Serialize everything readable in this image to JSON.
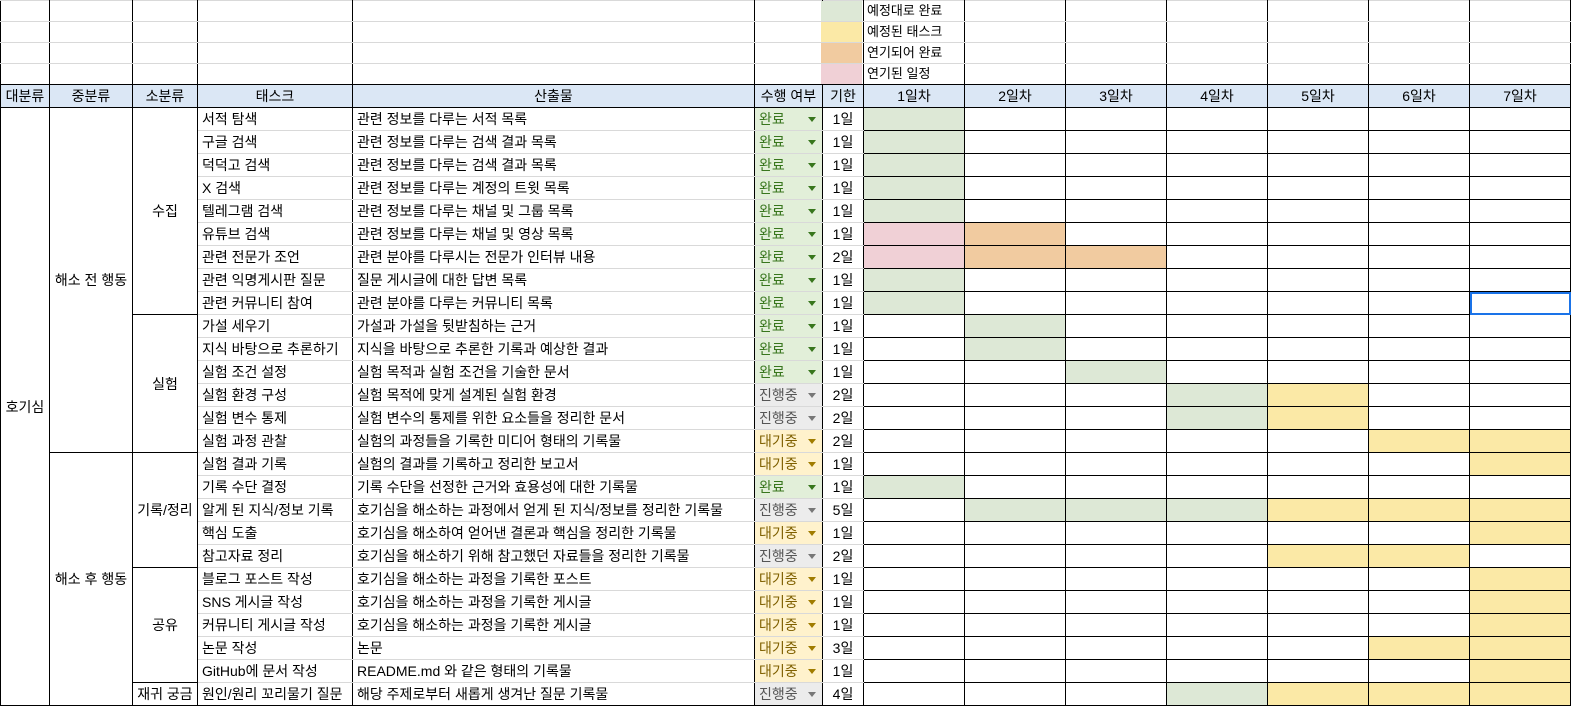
{
  "colors": {
    "header_bg": "#dbe7f5",
    "on_schedule_done": "#dde8d6",
    "scheduled_task": "#fbe9a6",
    "delayed_done": "#f1cba0",
    "delayed_schedule": "#f0d0d6",
    "status_done_bg": "#e2efd9",
    "status_done_text": "#38761d",
    "status_progress_bg": "#ececec",
    "status_progress_text": "#555555",
    "status_waiting_bg": "#fff2cc",
    "status_waiting_text": "#7f6000"
  },
  "legend": [
    {
      "label": "예정대로 완료",
      "color": "#dde8d6"
    },
    {
      "label": "예정된 태스크",
      "color": "#fbe9a6"
    },
    {
      "label": "연기되어 완료",
      "color": "#f1cba0"
    },
    {
      "label": "연기된 일정",
      "color": "#f0d0d6"
    }
  ],
  "headers": [
    "대분류",
    "중분류",
    "소분류",
    "태스크",
    "산출물",
    "수행 여부",
    "기한",
    "1일차",
    "2일차",
    "3일차",
    "4일차",
    "5일차",
    "6일차",
    "7일차"
  ],
  "major": "호기심",
  "mid_groups": [
    "해소 전 행동",
    "해소 후 행동"
  ],
  "sub_groups": [
    "수집",
    "실험",
    "기록/정리",
    "공유",
    "재귀 궁금"
  ],
  "rows": [
    {
      "task": "서적 탐색",
      "output": "관련 정보를 다루는 서적 목록",
      "status": "완료",
      "deadline": "1일",
      "days": [
        "G",
        "",
        "",
        "",
        "",
        "",
        ""
      ]
    },
    {
      "task": "구글 검색",
      "output": "관련 정보를 다루는 검색 결과 목록",
      "status": "완료",
      "deadline": "1일",
      "days": [
        "G",
        "",
        "",
        "",
        "",
        "",
        ""
      ]
    },
    {
      "task": "덕덕고 검색",
      "output": "관련 정보를 다루는 검색 결과 목록",
      "status": "완료",
      "deadline": "1일",
      "days": [
        "G",
        "",
        "",
        "",
        "",
        "",
        ""
      ]
    },
    {
      "task": "X 검색",
      "output": "관련 정보를 다루는 계정의 트윗 목록",
      "status": "완료",
      "deadline": "1일",
      "days": [
        "G",
        "",
        "",
        "",
        "",
        "",
        ""
      ]
    },
    {
      "task": "텔레그램 검색",
      "output": "관련 정보를 다루는 채널 및 그룹 목록",
      "status": "완료",
      "deadline": "1일",
      "days": [
        "G",
        "",
        "",
        "",
        "",
        "",
        ""
      ]
    },
    {
      "task": "유튜브 검색",
      "output": "관련 정보를 다루는 채널 및 영상 목록",
      "status": "완료",
      "deadline": "1일",
      "days": [
        "P",
        "O",
        "",
        "",
        "",
        "",
        ""
      ]
    },
    {
      "task": "관련 전문가 조언",
      "output": "관련 분야를 다루시는 전문가 인터뷰 내용",
      "status": "완료",
      "deadline": "2일",
      "days": [
        "P",
        "O",
        "O",
        "",
        "",
        "",
        ""
      ]
    },
    {
      "task": "관련 익명게시판 질문",
      "output": "질문 게시글에 대한 답변 목록",
      "status": "완료",
      "deadline": "1일",
      "days": [
        "G",
        "",
        "",
        "",
        "",
        "",
        ""
      ]
    },
    {
      "task": "관련 커뮤니티 참여",
      "output": "관련 분야를 다루는 커뮤니티 목록",
      "status": "완료",
      "deadline": "1일",
      "days": [
        "G",
        "",
        "",
        "",
        "",
        "",
        ""
      ]
    },
    {
      "task": "가설 세우기",
      "output": "가설과 가설을 뒷받침하는 근거",
      "status": "완료",
      "deadline": "1일",
      "days": [
        "",
        "G",
        "",
        "",
        "",
        "",
        ""
      ]
    },
    {
      "task": "지식 바탕으로 추론하기",
      "output": "지식을 바탕으로 추론한 기록과 예상한 결과",
      "status": "완료",
      "deadline": "1일",
      "days": [
        "",
        "G",
        "",
        "",
        "",
        "",
        ""
      ]
    },
    {
      "task": "실험 조건 설정",
      "output": "실험 목적과 실험 조건을 기술한 문서",
      "status": "완료",
      "deadline": "1일",
      "days": [
        "",
        "",
        "G",
        "",
        "",
        "",
        ""
      ]
    },
    {
      "task": "실험 환경 구성",
      "output": "실험 목적에 맞게 설계된 실험 환경",
      "status": "진행중",
      "deadline": "2일",
      "days": [
        "",
        "",
        "",
        "G",
        "Y",
        "",
        ""
      ]
    },
    {
      "task": "실험 변수 통제",
      "output": "실험 변수의 통제를 위한 요소들을 정리한 문서",
      "status": "진행중",
      "deadline": "2일",
      "days": [
        "",
        "",
        "",
        "G",
        "Y",
        "",
        ""
      ]
    },
    {
      "task": "실험 과정 관찰",
      "output": "실험의 과정들을 기록한 미디어 형태의 기록물",
      "status": "대기중",
      "deadline": "2일",
      "days": [
        "",
        "",
        "",
        "",
        "",
        "Y",
        "Y"
      ]
    },
    {
      "task": "실험 결과 기록",
      "output": "실험의 결과를 기록하고 정리한 보고서",
      "status": "대기중",
      "deadline": "1일",
      "days": [
        "",
        "",
        "",
        "",
        "",
        "",
        "Y"
      ]
    },
    {
      "task": "기록 수단 결정",
      "output": "기록 수단을 선정한 근거와 효용성에 대한 기록물",
      "status": "완료",
      "deadline": "1일",
      "days": [
        "G",
        "",
        "",
        "",
        "",
        "",
        ""
      ]
    },
    {
      "task": "알게 된 지식/정보 기록",
      "output": "호기심을 해소하는 과정에서 얻게 된 지식/정보를 정리한 기록물",
      "status": "진행중",
      "deadline": "5일",
      "days": [
        "",
        "G",
        "G",
        "G",
        "Y",
        "Y",
        "Y"
      ]
    },
    {
      "task": "핵심 도출",
      "output": "호기심을 해소하여 얻어낸 결론과 핵심을 정리한 기록물",
      "status": "대기중",
      "deadline": "1일",
      "days": [
        "",
        "",
        "",
        "",
        "",
        "",
        "Y"
      ]
    },
    {
      "task": "참고자료 정리",
      "output": "호기심을 해소하기 위해 참고했던 자료들을 정리한 기록물",
      "status": "진행중",
      "deadline": "2일",
      "days": [
        "",
        "",
        "",
        "",
        "Y",
        "Y",
        ""
      ]
    },
    {
      "task": "블로그 포스트 작성",
      "output": "호기심을 해소하는 과정을 기록한 포스트",
      "status": "대기중",
      "deadline": "1일",
      "days": [
        "",
        "",
        "",
        "",
        "",
        "",
        "Y"
      ]
    },
    {
      "task": "SNS 게시글 작성",
      "output": "호기심을 해소하는 과정을 기록한 게시글",
      "status": "대기중",
      "deadline": "1일",
      "days": [
        "",
        "",
        "",
        "",
        "",
        "",
        "Y"
      ]
    },
    {
      "task": "커뮤니티 게시글 작성",
      "output": "호기심을 해소하는 과정을 기록한 게시글",
      "status": "대기중",
      "deadline": "1일",
      "days": [
        "",
        "",
        "",
        "",
        "",
        "",
        "Y"
      ]
    },
    {
      "task": "논문 작성",
      "output": "논문",
      "status": "대기중",
      "deadline": "3일",
      "days": [
        "",
        "",
        "",
        "",
        "",
        "Y",
        "Y"
      ]
    },
    {
      "task": "GitHub에 문서 작성",
      "output": "README.md 와 같은 형태의 기록물",
      "status": "대기중",
      "deadline": "1일",
      "days": [
        "",
        "",
        "",
        "",
        "",
        "",
        "Y"
      ]
    },
    {
      "task": "원인/원리 꼬리물기 질문",
      "output": "해당 주제로부터 새롭게 생겨난 질문 기록물",
      "status": "진행중",
      "deadline": "4일",
      "days": [
        "",
        "",
        "",
        "G",
        "Y",
        "Y",
        "Y"
      ]
    }
  ]
}
